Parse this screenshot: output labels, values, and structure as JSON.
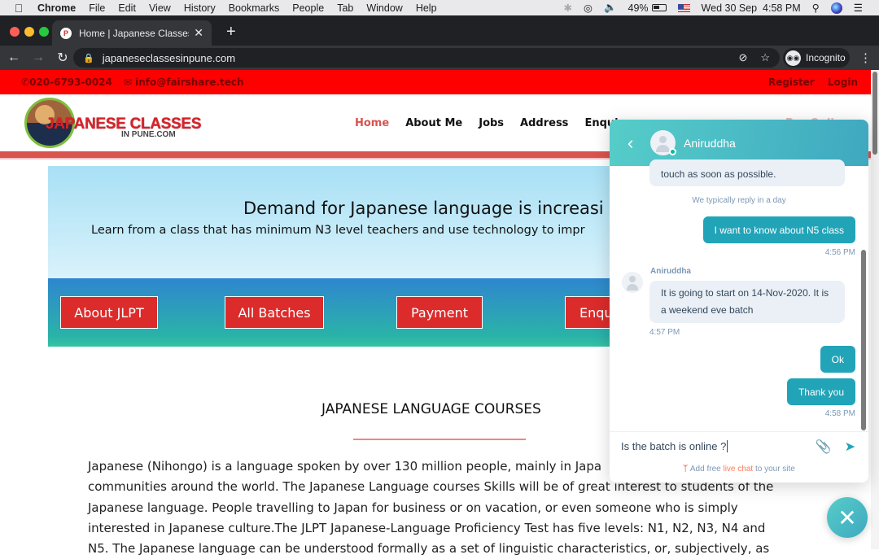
{
  "menubar": {
    "app": "Chrome",
    "items": [
      "File",
      "Edit",
      "View",
      "History",
      "Bookmarks",
      "People",
      "Tab",
      "Window",
      "Help"
    ],
    "battery": "49%",
    "datetime": "Wed 30 Sep  4:58 PM"
  },
  "browser": {
    "tab_title": "Home | Japanese Classes in Pu",
    "url": "japaneseclassesinpune.com",
    "profile_label": "Incognito",
    "favicon_text": "P"
  },
  "site": {
    "phone": "020-6793-0024",
    "email": "info@fairshare.tech",
    "register": "Register",
    "login": "Login",
    "logo_line1": "JAPANESE CLASSES",
    "logo_line2": "IN PUNE.COM",
    "nav": [
      "Home",
      "About Me",
      "Jobs",
      "Address",
      "Enquiry"
    ],
    "nav_hidden": "Pay Onli",
    "hero": {
      "title": "Demand for Japanese language is increasi",
      "subtitle": "Learn from a class that has minimum N3 level teachers and use technology to impr",
      "buttons": [
        "About JLPT",
        "All Batches",
        "Payment",
        "Enqu"
      ]
    },
    "section_title": "JAPANESE LANGUAGE COURSES",
    "body_lines": [
      "Japanese (Nihongo) is a language spoken by over 130 million people, mainly in Japa",
      "communities around the world. The Japanese Language courses Skills will be of great interest to students of the",
      "Japanese language. People travelling to Japan for business or on vacation, or even someone who is simply",
      "interested in Japanese culture.The JLPT Japanese-Language Proficiency Test has five levels: N1, N2, N3, N4 and",
      "N5. The Japanese language can be understood formally as a set of linguistic characteristics, or, subjectively, as"
    ]
  },
  "chat": {
    "agent_name": "Aniruddha",
    "messages": [
      {
        "from": "agent",
        "text": "touch as soon as possible."
      },
      {
        "type": "note",
        "text": "We typically reply in a day"
      },
      {
        "from": "visitor",
        "text": "I want to know about N5 class",
        "time": "4:56 PM"
      },
      {
        "from": "agent",
        "sender": "Aniruddha",
        "lines": [
          "It is going to start on 14-Nov-2020. It is",
          "a weekend eve batch"
        ],
        "time": "4:57 PM"
      },
      {
        "from": "visitor",
        "text": "Ok"
      },
      {
        "from": "visitor",
        "text": "Thank you",
        "time": "4:58 PM"
      }
    ],
    "input_value": "Is the batch is online ?",
    "footer_pre": "Add free ",
    "footer_link": "live chat",
    "footer_post": " to your site"
  }
}
